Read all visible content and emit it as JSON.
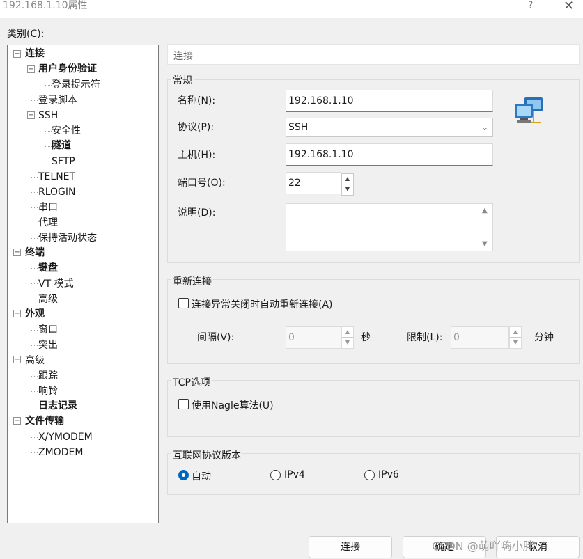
{
  "window": {
    "title": "192.168.1.10属性",
    "help": "?",
    "close": "✕"
  },
  "category_label": "类别(C):",
  "tree": {
    "items": [
      {
        "label": "连接",
        "bold": true
      },
      {
        "label": "用户身份验证",
        "bold": true
      },
      {
        "label": "登录提示符",
        "bold": false
      },
      {
        "label": "登录脚本",
        "bold": false
      },
      {
        "label": "SSH",
        "bold": false
      },
      {
        "label": "安全性",
        "bold": false
      },
      {
        "label": "隧道",
        "bold": true
      },
      {
        "label": "SFTP",
        "bold": false
      },
      {
        "label": "TELNET",
        "bold": false
      },
      {
        "label": "RLOGIN",
        "bold": false
      },
      {
        "label": "串口",
        "bold": false
      },
      {
        "label": "代理",
        "bold": false
      },
      {
        "label": "保持活动状态",
        "bold": false
      },
      {
        "label": "终端",
        "bold": true
      },
      {
        "label": "键盘",
        "bold": true
      },
      {
        "label": "VT 模式",
        "bold": false
      },
      {
        "label": "高级",
        "bold": false
      },
      {
        "label": "外观",
        "bold": true
      },
      {
        "label": "窗口",
        "bold": false
      },
      {
        "label": "突出",
        "bold": false
      },
      {
        "label": "高级",
        "bold": false
      },
      {
        "label": "跟踪",
        "bold": false
      },
      {
        "label": "响铃",
        "bold": false
      },
      {
        "label": "日志记录",
        "bold": true
      },
      {
        "label": "文件传输",
        "bold": true
      },
      {
        "label": "X/YMODEM",
        "bold": false
      },
      {
        "label": "ZMODEM",
        "bold": false
      }
    ]
  },
  "panel_header": "连接",
  "general": {
    "title": "常规",
    "name_label": "名称(N):",
    "name_value": "192.168.1.10",
    "protocol_label": "协议(P):",
    "protocol_value": "SSH",
    "host_label": "主机(H):",
    "host_value": "192.168.1.10",
    "port_label": "端口号(O):",
    "port_value": "22",
    "desc_label": "说明(D):",
    "desc_value": ""
  },
  "reconnect": {
    "title": "重新连接",
    "checkbox_label": "连接异常关闭时自动重新连接(A)",
    "checked": false,
    "interval_label": "间隔(V):",
    "interval_value": "0",
    "interval_unit": "秒",
    "limit_label": "限制(L):",
    "limit_value": "0",
    "limit_unit": "分钟"
  },
  "tcp": {
    "title": "TCP选项",
    "nagle_label": "使用Nagle算法(U)",
    "checked": false
  },
  "ipver": {
    "title": "互联网协议版本",
    "options": [
      {
        "label": "自动",
        "checked": true
      },
      {
        "label": "IPv4",
        "checked": false
      },
      {
        "label": "IPv6",
        "checked": false
      }
    ]
  },
  "buttons": {
    "connect": "连接",
    "ok": "确定",
    "cancel": "取消"
  },
  "watermark": "CSDN @萌吖嗨小胖",
  "colors": {
    "accent": "#0067c0",
    "background": "#f0f0f0"
  },
  "icons": {
    "connection": "computer-network-icon",
    "expand": "minus-box-icon"
  }
}
